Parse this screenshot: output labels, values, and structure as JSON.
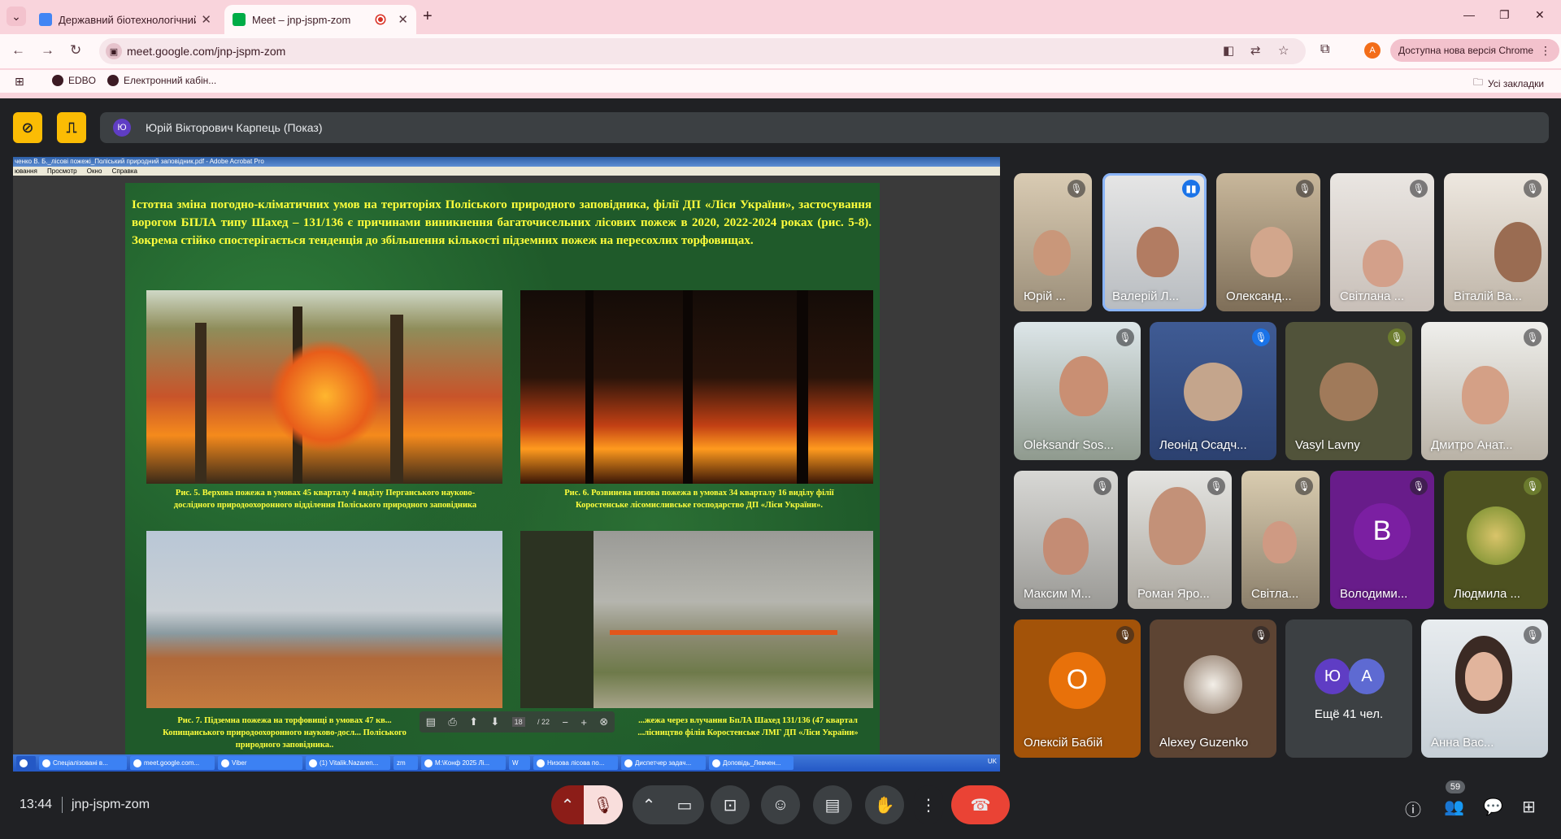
{
  "browser": {
    "tabs": [
      {
        "title": "Державний біотехнологічний",
        "active": false
      },
      {
        "title": "Meet – jnp-jspm-zom",
        "active": true
      }
    ],
    "url": "meet.google.com/jnp-jspm-zom",
    "profile_initial": "A",
    "update_label": "Доступна нова версія Chrome",
    "bookmarks": [
      "EDBO",
      "Електронний кабін..."
    ],
    "all_bookmarks": "Усі закладки"
  },
  "meet": {
    "presenter_initial": "Ю",
    "presenter": "Юрій Вікторович Карпець (Показ)",
    "time": "13:44",
    "meeting_code": "jnp-jspm-zom",
    "participant_count": "59",
    "accent": "#8ab4f8",
    "end_color": "#ea4335"
  },
  "shared": {
    "acrobat_title": "ченко В. Б._лісові пожежі_Поліський природний заповідник.pdf - Adobe Acrobat Pro",
    "menu": [
      "ювання",
      "Просмотр",
      "Окно",
      "Справка"
    ],
    "heading": "Істотна зміна погодно-кліматичних умов на територіях Поліського природного заповідника, філії ДП «Ліси України», застосування ворогом БПЛА типу Шахед – 131/136 є причинами виникнення багаточисельних лісових пожеж в 2020, 2022-2024 роках (рис. 5-8). Зокрема стійко спостерігається тенденція до збільшення кількості підземних пожеж на пересохлих торфовищах.",
    "captions": [
      "Рис. 5. Верхова пожежа в умовах 45 кварталу 4 виділу Перганського науково-дослідного природоохоронного відділення Поліського природного заповідника",
      "Рис. 6. Розвинена низова пожежа в умовах 34 кварталу 16 виділу філії Коростенське лісомисливське господарство ДП «Ліси України».",
      "Рис. 7. Підземна пожежа на торфовищі в умовах 47 кв... Копищанського природоохоронного науково-досл... Поліського природного заповідника..",
      "...жежа через влучання БпЛА Шахед 131/136 (47 квартал ...лісництво філія Коростенське ЛМГ ДП «Ліси України»"
    ],
    "page_current": "18",
    "page_total": "/ 22",
    "taskbar": [
      "Спеціалізовані в...",
      "meet.google.com...",
      "Viber",
      "(1) Vitalik.Nazaren...",
      "zm",
      "M:\\Конф 2025 Лі...",
      "W",
      "Низова лісова по...",
      "Диспетчер задач...",
      "Доповідь_Левчен..."
    ],
    "tray_lang": "UK"
  },
  "participants": [
    {
      "name": "Юрій ...",
      "muted": true
    },
    {
      "name": "Валерій Л...",
      "muted": false
    },
    {
      "name": "Олександ...",
      "muted": true
    },
    {
      "name": "Світлана ...",
      "muted": true
    },
    {
      "name": "Віталій Ва...",
      "muted": true
    },
    {
      "name": "Oleksandr Sos...",
      "muted": true
    },
    {
      "name": "Леонід Осадч...",
      "muted": true
    },
    {
      "name": "Vasyl Lavny",
      "muted": true
    },
    {
      "name": "Дмитро Анат...",
      "muted": true
    },
    {
      "name": "Максим М...",
      "muted": true
    },
    {
      "name": "Роман Яро...",
      "muted": true
    },
    {
      "name": "Світла...",
      "muted": true
    },
    {
      "name": "Володими...",
      "muted": true,
      "initial": "В",
      "color": "#7b1fa2"
    },
    {
      "name": "Людмила ...",
      "muted": true
    },
    {
      "name": "Олексій Бабій",
      "muted": true,
      "initial": "О",
      "color": "#e8710a"
    },
    {
      "name": "Alexey Guzenko",
      "muted": true
    },
    {
      "name": "Ещё 41 чел.",
      "initials": [
        "Ю",
        "А"
      ]
    },
    {
      "name": "Анна Вас...",
      "muted": true
    }
  ]
}
